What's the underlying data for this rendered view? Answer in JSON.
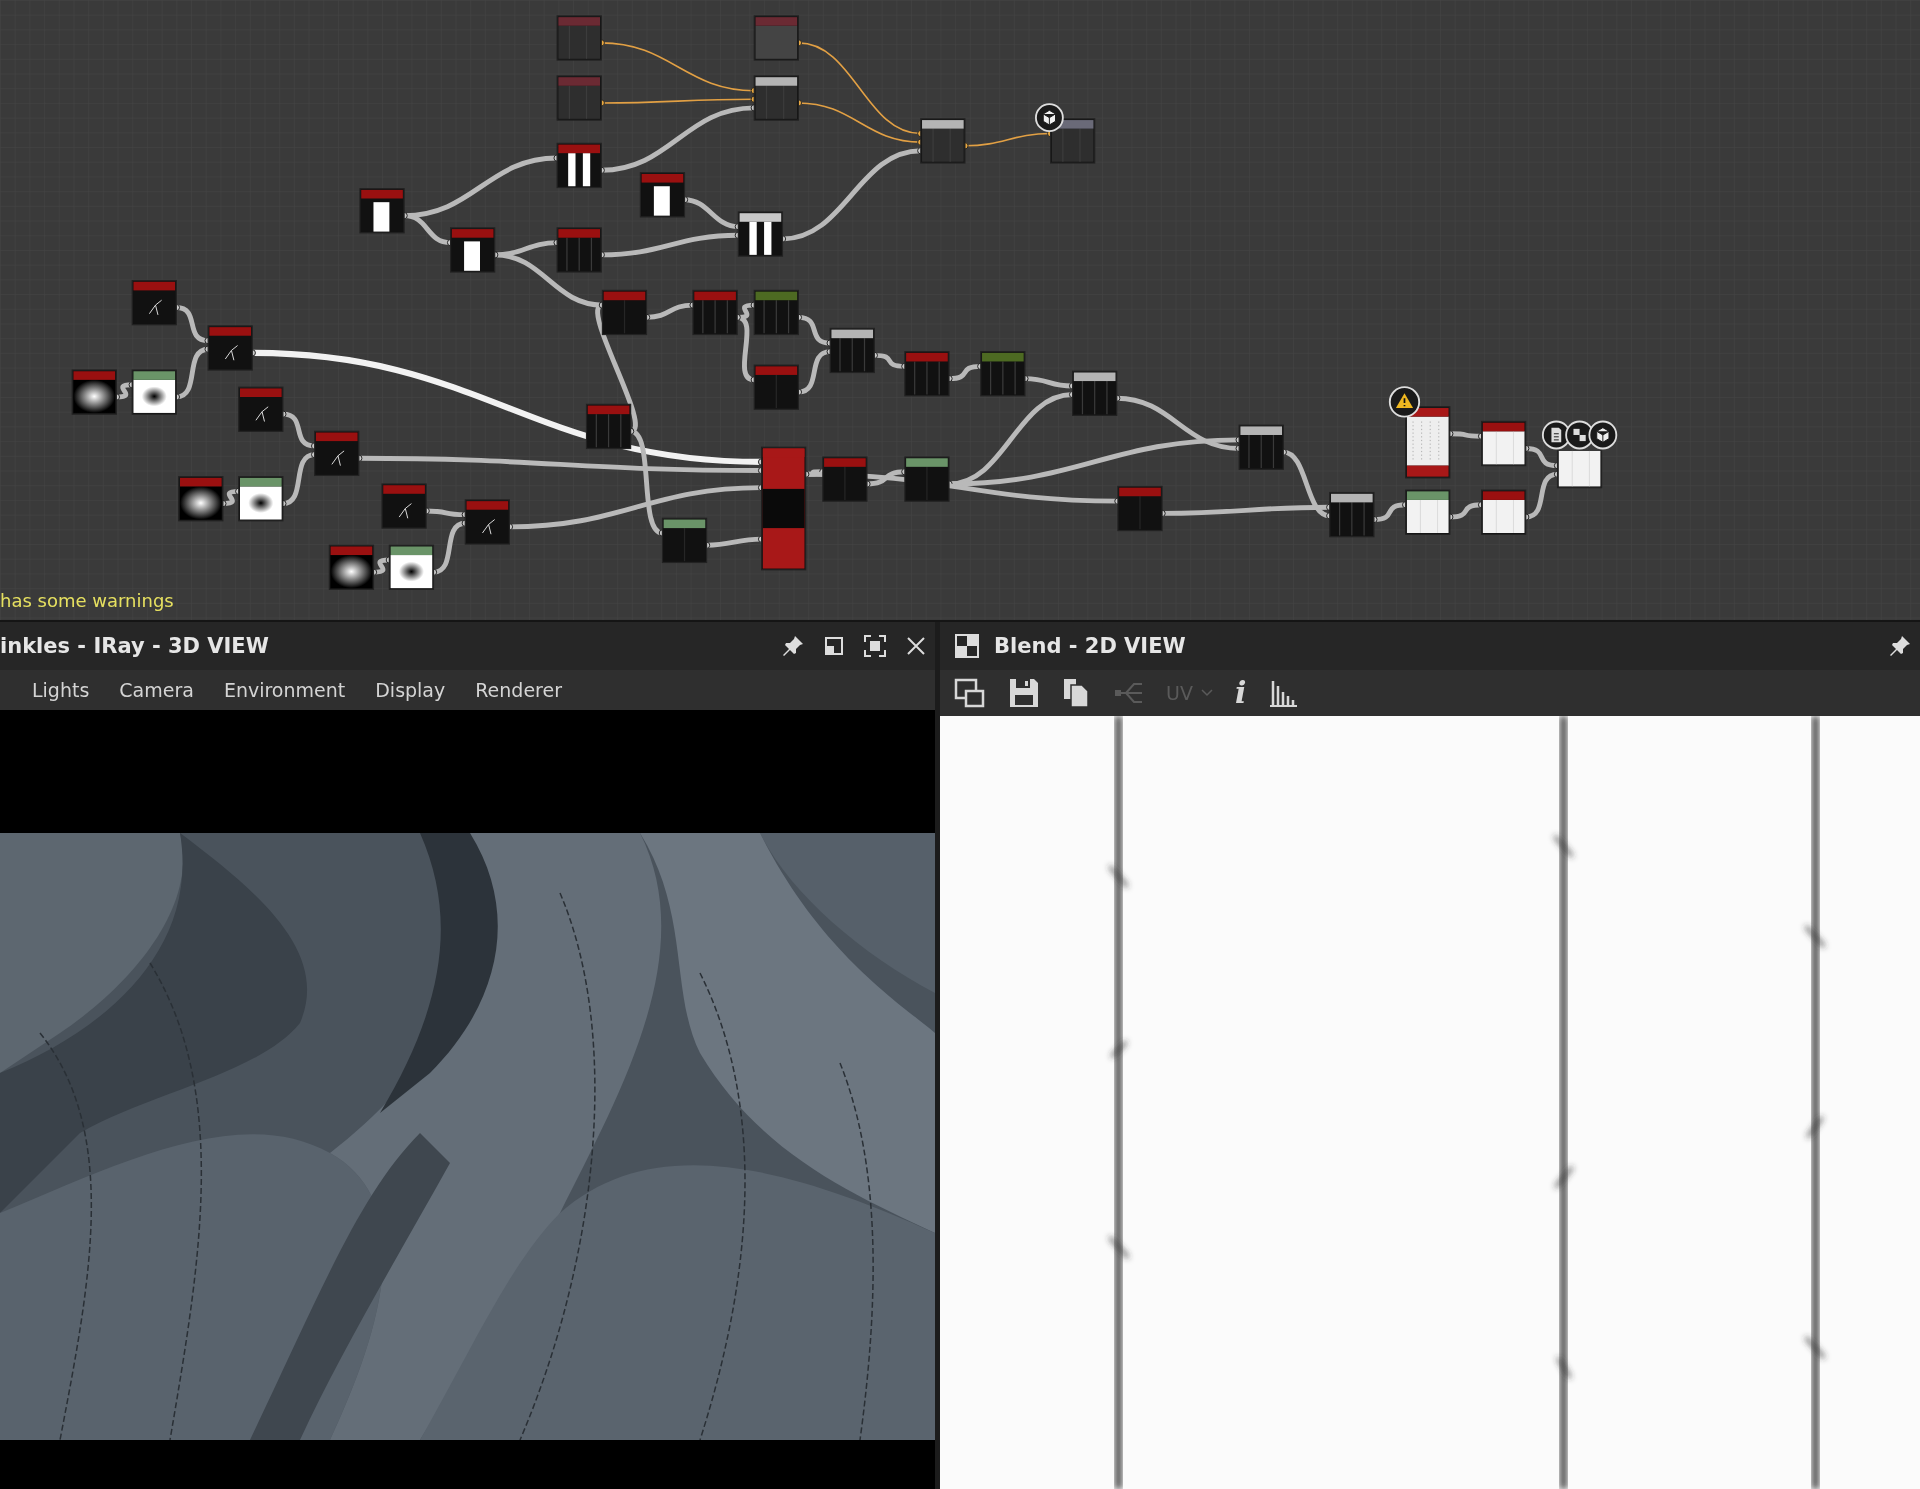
{
  "node_graph": {
    "nodes": [
      {
        "kind": "dark",
        "color": "#6b2a33"
      },
      {
        "kind": "dark",
        "color": "#6b2a33"
      },
      {
        "kind": "grey",
        "color": "#6b2a33"
      },
      {
        "kind": "dark",
        "color": "#b4b4b4"
      },
      {
        "kind": "dark",
        "color": "#b4b4b4"
      },
      {
        "kind": "dark",
        "color": "#6a6a78",
        "badges": [
          {
            "kind": "cube"
          }
        ]
      },
      {
        "kind": "bars",
        "color": "#9a1010"
      },
      {
        "kind": "white-bar",
        "color": "#9a1010"
      },
      {
        "kind": "white-bar",
        "color": "#9a1010"
      },
      {
        "kind": "white-bar",
        "color": "#9a1010"
      },
      {
        "kind": "lines",
        "color": "#9a1010"
      },
      {
        "kind": "bars",
        "color": "#c8c8c8"
      },
      {
        "kind": "spark",
        "color": "#9a1010"
      },
      {
        "kind": "spark",
        "color": "#9a1010"
      },
      {
        "kind": "radial",
        "color": "#9a1010"
      },
      {
        "kind": "radial-inverse",
        "color": "#6a9468"
      },
      {
        "kind": "spark",
        "color": "#9a1010"
      },
      {
        "kind": "spark",
        "color": "#9a1010"
      },
      {
        "kind": "radial",
        "color": "#9a1010"
      },
      {
        "kind": "radial-inverse",
        "color": "#6a9468"
      },
      {
        "kind": "spark",
        "color": "#9a1010"
      },
      {
        "kind": "spark",
        "color": "#9a1010"
      },
      {
        "kind": "radial",
        "color": "#9a1010"
      },
      {
        "kind": "radial-inverse",
        "color": "#6a9468"
      },
      {
        "kind": "black",
        "color": "#9a1010"
      },
      {
        "kind": "lines",
        "color": "#9a1010"
      },
      {
        "kind": "lines",
        "color": "#4d6a22"
      },
      {
        "kind": "black",
        "color": "#9a1010"
      },
      {
        "kind": "lines",
        "color": "#b4b4b4"
      },
      {
        "kind": "lines",
        "color": "#9a1010"
      },
      {
        "kind": "lines",
        "color": "#4d6a22"
      },
      {
        "kind": "lines",
        "color": "#b4b4b4"
      },
      {
        "kind": "lines",
        "color": "#9a1010"
      },
      {
        "kind": "black",
        "color": "#6a9468"
      },
      {
        "kind": "stack",
        "color": "#a81818"
      },
      {
        "kind": "black",
        "color": "#9a1010"
      },
      {
        "kind": "black",
        "color": "#6a9468"
      },
      {
        "kind": "black",
        "color": "#9a1010"
      },
      {
        "kind": "lines",
        "color": "#b4b4b4"
      },
      {
        "kind": "lines",
        "color": "#b4b4b4"
      },
      {
        "kind": "noise",
        "color": "#a81818",
        "badges": [
          {
            "kind": "warning"
          }
        ]
      },
      {
        "kind": "white",
        "color": "#9a1010"
      },
      {
        "kind": "white",
        "color": "#6a9468"
      },
      {
        "kind": "white",
        "color": "#9a1010"
      },
      {
        "kind": "white",
        "badges": [
          {
            "kind": "document"
          },
          {
            "kind": "checker"
          },
          {
            "kind": "cube"
          }
        ]
      }
    ],
    "status_message": "has some warnings"
  },
  "view_3d": {
    "title": "inkles - IRay - 3D VIEW",
    "menu": [
      "Lights",
      "Camera",
      "Environment",
      "Display",
      "Renderer"
    ]
  },
  "view_2d": {
    "title": "Blend - 2D VIEW",
    "toolbar": [
      {
        "kind": "screenshot",
        "disabled": false
      },
      {
        "kind": "save",
        "disabled": false
      },
      {
        "kind": "copy",
        "disabled": false
      },
      {
        "kind": "share",
        "disabled": true
      },
      {
        "kind": "dropdown",
        "label": "UV",
        "disabled": true
      },
      {
        "kind": "info",
        "label": "i",
        "disabled": false
      },
      {
        "kind": "histogram",
        "disabled": false
      }
    ]
  }
}
